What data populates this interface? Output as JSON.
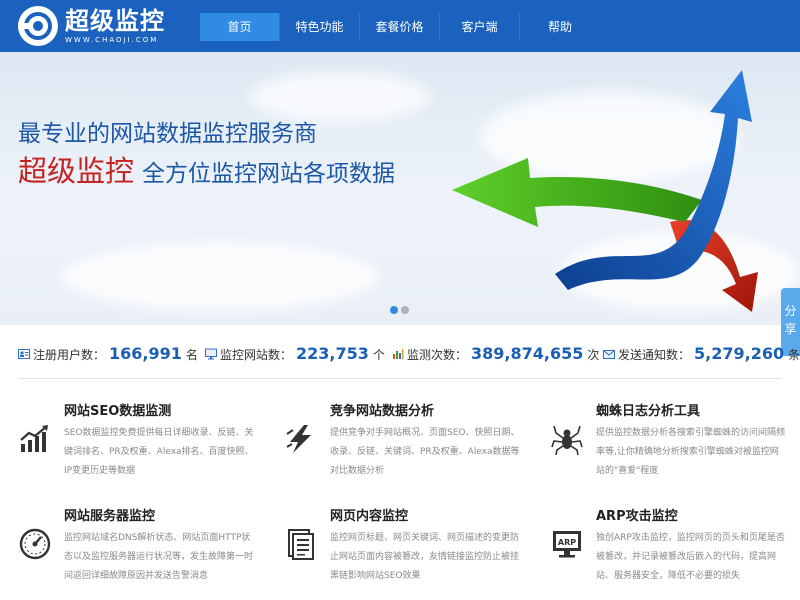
{
  "header": {
    "logo_title": "超级监控",
    "logo_sub": "WWW.CHAOJI.COM",
    "nav": [
      {
        "label": "首页",
        "active": true
      },
      {
        "label": "特色功能",
        "active": false
      },
      {
        "label": "套餐价格",
        "active": false
      },
      {
        "label": "客户端",
        "active": false
      },
      {
        "label": "帮助",
        "active": false
      }
    ]
  },
  "banner": {
    "line1": "最专业的网站数据监控服务商",
    "brand": "超级监控",
    "slogan": "全方位监控网站各项数据",
    "slides": 2,
    "active_slide": 0
  },
  "share": {
    "line1": "分",
    "line2": "享"
  },
  "stats": [
    {
      "icon": "user-card-icon",
      "label": "注册用户数：",
      "value": "166,991",
      "unit": "名"
    },
    {
      "icon": "monitor-icon",
      "label": "监控网站数：",
      "value": "223,753",
      "unit": "个"
    },
    {
      "icon": "bar-chart-icon",
      "label": "监测次数：",
      "value": "389,874,655",
      "unit": "次"
    },
    {
      "icon": "mail-icon",
      "label": "发送通知数：",
      "value": "5,279,260",
      "unit": "条"
    }
  ],
  "features": [
    {
      "icon": "seo-chart-icon",
      "title": "网站SEO数据监测",
      "desc": "SEO数据监控免费提供每日详细收录、反链、关键词排名、PR及权重、Alexa排名、百度快照、IP变更历史等数据"
    },
    {
      "icon": "lightning-icon",
      "title": "竞争网站数据分析",
      "desc": "提供竞争对手网站概况、页面SEO、快照日期、收录、反链、关键词、PR及权重、Alexa数据等对比数据分析"
    },
    {
      "icon": "spider-icon",
      "title": "蜘蛛日志分析工具",
      "desc": "提供监控数据分析各搜索引擎蜘蛛的访问间隔频率等,让你精确地分析搜索引擎蜘蛛对被监控网站的\"喜爱\"程度"
    },
    {
      "icon": "gauge-icon",
      "title": "网站服务器监控",
      "desc": "监控网站域名DNS解析状态、网站页面HTTP状态以及监控服务器运行状况等，发生故障第一时间返回详细故障原因并发送告警消息"
    },
    {
      "icon": "document-icon",
      "title": "网页内容监控",
      "desc": "监控网页标题、网页关键词、网页描述的变更防止网站页面内容被篡改，友情链接监控防止被挂黑链影响网站SEO效果"
    },
    {
      "icon": "arp-screen-icon",
      "title": "ARP攻击监控",
      "desc": "独创ARP攻击监控，监控网页的页头和页尾是否被篡改，并记录被篡改后嵌入的代码，提高网站、服务器安全，降低不必要的损失",
      "icon_text": "ARP"
    }
  ]
}
